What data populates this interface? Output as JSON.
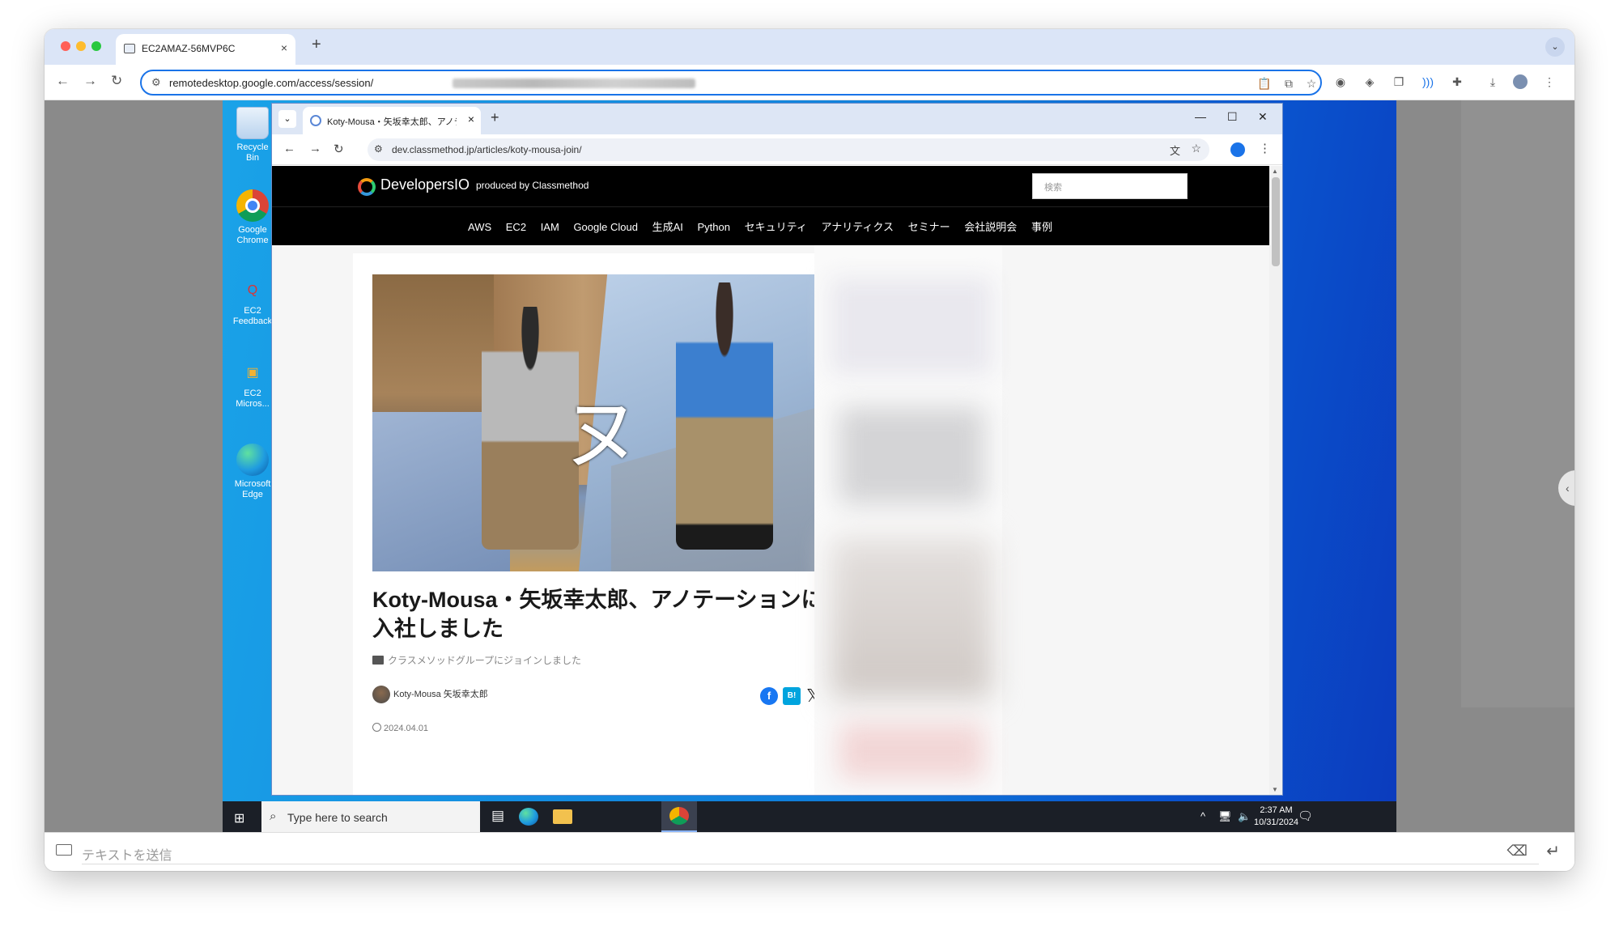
{
  "outer_browser": {
    "tab_title": "EC2AMAZ-56MVP6C",
    "close": "×",
    "new_tab": "+",
    "url": "remotedesktop.google.com/access/session/"
  },
  "desktop": {
    "icons": [
      "Recycle Bin",
      "Google Chrome",
      "EC2 Feedback",
      "EC2 Micros...",
      "Microsoft Edge"
    ]
  },
  "inner_browser": {
    "tab_title": "Koty-Mousa・矢坂幸太郎、アノテ",
    "close": "×",
    "new_tab": "+",
    "url": "dev.classmethod.jp/articles/koty-mousa-join/"
  },
  "site": {
    "logo": "DevelopersIO",
    "logo_sub": "produced by Classmethod",
    "search_placeholder": "検索",
    "nav": [
      "AWS",
      "EC2",
      "IAM",
      "Google Cloud",
      "生成AI",
      "Python",
      "セキュリティ",
      "アナリティクス",
      "セミナー",
      "会社説明会",
      "事例"
    ]
  },
  "article": {
    "hero_text": "ヌ",
    "title": "Koty-Mousa・矢坂幸太郎、アノテーションに入社しました",
    "category": "クラスメソッドグループにジョインしました",
    "author": "Koty-Mousa 矢坂幸太郎",
    "date": "2024.04.01",
    "share_fb": "f",
    "share_hb": "B!",
    "share_x": "𝕏"
  },
  "taskbar": {
    "search_placeholder": "Type here to search",
    "time": "2:37 AM",
    "date": "10/31/2024"
  },
  "send_bar": {
    "placeholder": "テキストを送信"
  }
}
